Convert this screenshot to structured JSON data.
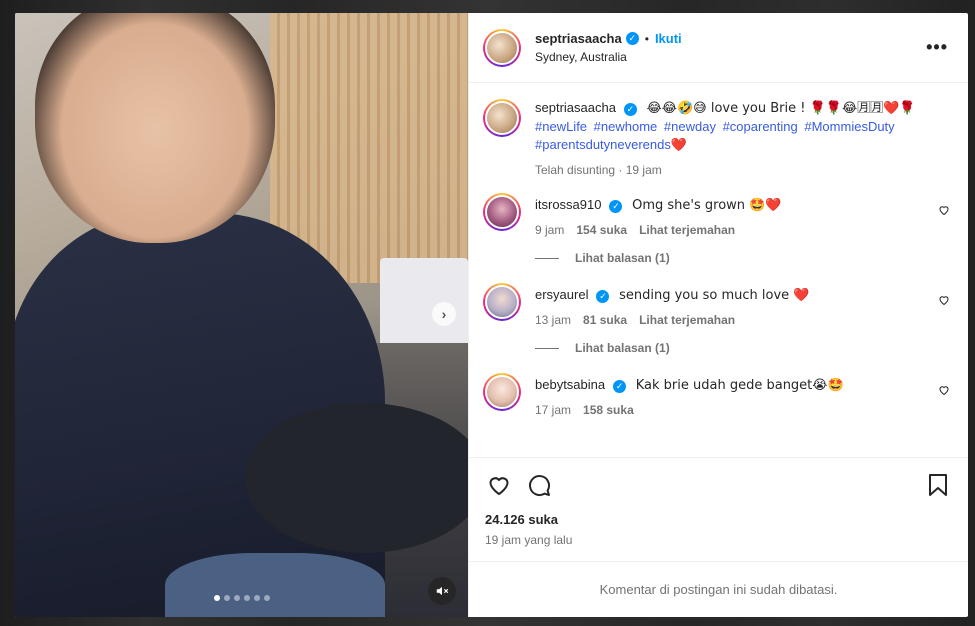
{
  "post": {
    "author": "septriasaacha",
    "follow_label": "Ikuti",
    "separator": "•",
    "location": "Sydney, Australia",
    "more_label": "•••"
  },
  "caption": {
    "username": "septriasaacha",
    "text": "😂😂🤣😅 love you Brie ! 🌹🌹😂🈷🈷❤️🌹",
    "tags": [
      "#newLife",
      "#newhome",
      "#newday",
      "#coparenting",
      "#MommiesDuty",
      "#parentsdutyneverends"
    ],
    "tail": "❤️",
    "edited": "Telah disunting · 19 jam"
  },
  "comments": [
    {
      "username": "itsrossa910",
      "text": "Omg she's grown 🤩❤️",
      "time": "9 jam",
      "likes": "154 suka",
      "translate": "Lihat terjemahan",
      "replies": "Lihat balasan (1)"
    },
    {
      "username": "ersyaurel",
      "text": "sending you so much love ❤️",
      "time": "13 jam",
      "likes": "81 suka",
      "translate": "Lihat terjemahan",
      "replies": "Lihat balasan (1)"
    },
    {
      "username": "bebytsabina",
      "text": "Kak brie udah gede banget😭🤩",
      "time": "17 jam",
      "likes": "158 suka"
    }
  ],
  "stats": {
    "likes": "24.126 suka",
    "posted": "19 jam yang lalu"
  },
  "footer": {
    "disabled_text": "Komentar di postingan ini sudah dibatasi."
  },
  "media": {
    "next_glyph": "›",
    "slide_count": 6,
    "active_slide": 1
  },
  "colors": {
    "accent": "#0095f6",
    "hashtag": "#385ce0",
    "muted": "#737373"
  }
}
